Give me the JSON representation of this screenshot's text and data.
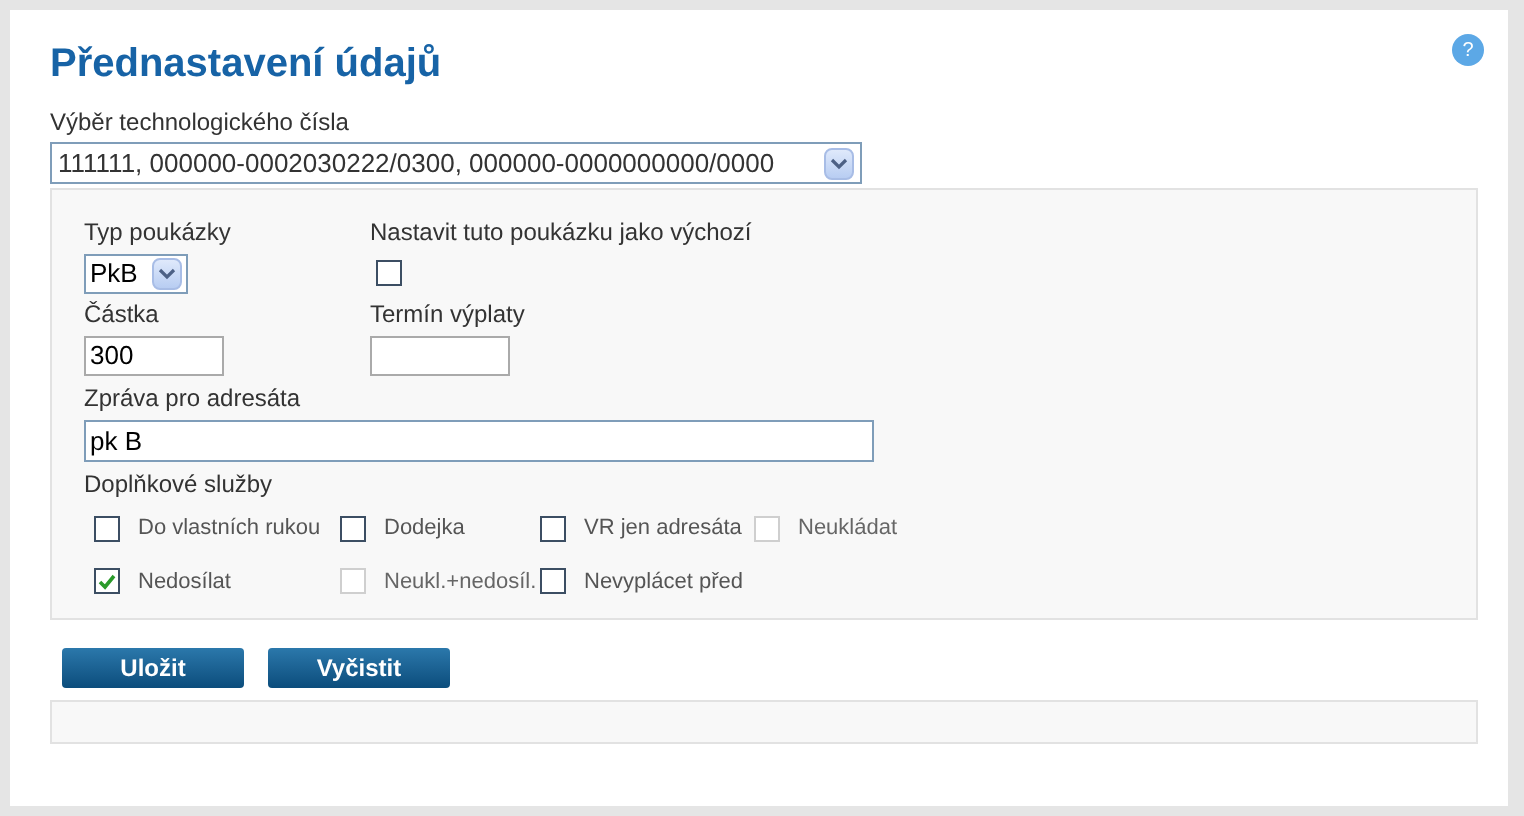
{
  "title": "Přednastavení údajů",
  "help": "?",
  "account": {
    "label": "Výběr technologického čísla",
    "value": "111111, 000000-0002030222/0300, 000000-0000000000/0000"
  },
  "type": {
    "label": "Typ poukázky",
    "value": "PkB"
  },
  "default": {
    "label": "Nastavit tuto poukázku jako výchozí",
    "checked": false
  },
  "amount": {
    "label": "Částka",
    "value": "300"
  },
  "date": {
    "label": "Termín výplaty"
  },
  "message": {
    "label": "Zpráva pro adresáta",
    "value": "pk B"
  },
  "services": {
    "label": "Doplňkové služby",
    "items": [
      {
        "label": "Do vlastních rukou",
        "checked": false,
        "disabled": false
      },
      {
        "label": "Dodejka",
        "checked": false,
        "disabled": false
      },
      {
        "label": "VR jen adresáta",
        "checked": false,
        "disabled": false
      },
      {
        "label": "Neukládat",
        "checked": false,
        "disabled": true
      },
      {
        "label": "Nedosílat",
        "checked": true,
        "disabled": false
      },
      {
        "label": "Neukl.+nedosíl.",
        "checked": false,
        "disabled": true
      },
      {
        "label": "Nevyplácet před",
        "checked": false,
        "disabled": false
      }
    ]
  },
  "buttons": [
    "Uložit",
    "Vyčistit"
  ]
}
